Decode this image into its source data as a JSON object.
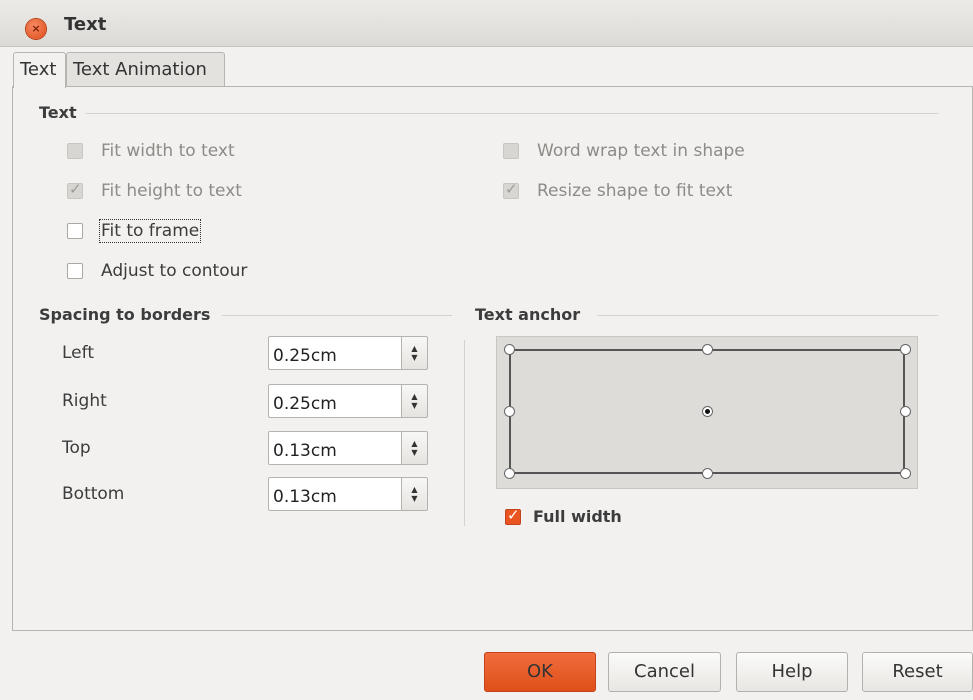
{
  "window": {
    "title": "Text"
  },
  "tabs": [
    {
      "label": "Text"
    },
    {
      "label": "Text Animation"
    }
  ],
  "text_section": {
    "label": "Text",
    "fit_width": {
      "label": "Fit width to text",
      "checked": false,
      "enabled": false
    },
    "fit_height": {
      "label": "Fit height to text",
      "checked": true,
      "enabled": false
    },
    "fit_frame": {
      "label": "Fit to frame",
      "checked": false,
      "enabled": true
    },
    "adjust_contour": {
      "label": "Adjust to contour",
      "checked": false,
      "enabled": true
    },
    "word_wrap": {
      "label": "Word wrap text in shape",
      "checked": false,
      "enabled": false
    },
    "resize_shape": {
      "label": "Resize shape to fit text",
      "checked": true,
      "enabled": false
    }
  },
  "spacing": {
    "label": "Spacing to borders",
    "left": {
      "label": "Left",
      "value": "0.25cm"
    },
    "right": {
      "label": "Right",
      "value": "0.25cm"
    },
    "top": {
      "label": "Top",
      "value": "0.13cm"
    },
    "bottom": {
      "label": "Bottom",
      "value": "0.13cm"
    }
  },
  "anchor": {
    "label": "Text anchor",
    "selected": "center",
    "full_width": {
      "label": "Full width",
      "checked": true
    }
  },
  "buttons": {
    "ok": "OK",
    "cancel": "Cancel",
    "help": "Help",
    "reset": "Reset"
  },
  "colors": {
    "accent": "#e95420",
    "background": "#f2f1f0"
  }
}
